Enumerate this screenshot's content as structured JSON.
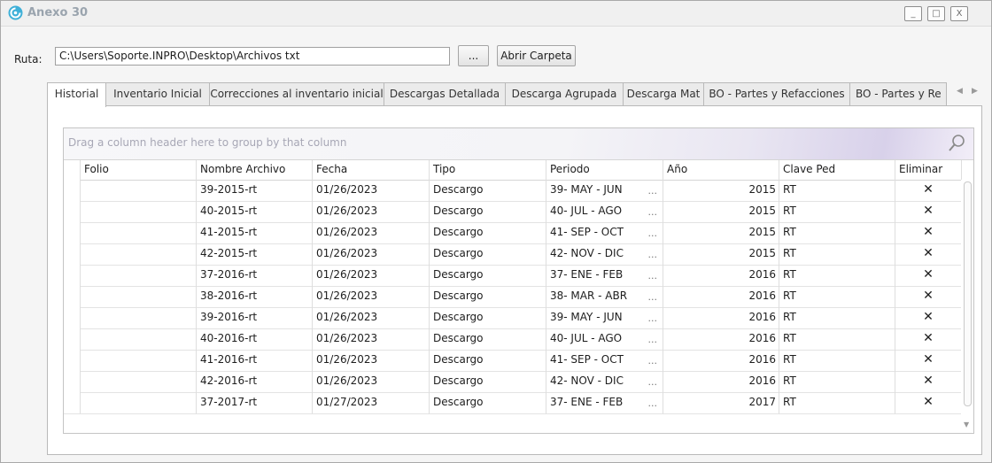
{
  "window": {
    "title": "Anexo 30",
    "minimize_label": "_",
    "maximize_label": "□",
    "close_label": "X"
  },
  "ruta": {
    "label": "Ruta:",
    "value": "C:\\Users\\Soporte.INPRO\\Desktop\\Archivos txt",
    "browse_label": "...",
    "open_folder_label": "Abrir Carpeta"
  },
  "tabs": [
    {
      "label": "Historial"
    },
    {
      "label": "Inventario Inicial"
    },
    {
      "label": "Correcciones al inventario inicial"
    },
    {
      "label": "Descargas Detallada"
    },
    {
      "label": "Descarga Agrupada"
    },
    {
      "label": "Descarga Mat"
    },
    {
      "label": "BO - Partes y Refacciones"
    },
    {
      "label": "BO - Partes y Re"
    }
  ],
  "tab_scroll": {
    "left": "◀",
    "right": "▶"
  },
  "grid": {
    "group_hint": "Drag a column header here to group by that column",
    "columns": [
      "Folio",
      "Nombre Archivo",
      "Fecha",
      "Tipo",
      "Periodo",
      "Año",
      "Clave Ped",
      "Eliminar"
    ],
    "ellipsis": "...",
    "delete_glyph": "✕",
    "rows": [
      {
        "folio": "",
        "nombre": "39-2015-rt",
        "fecha": "01/26/2023",
        "tipo": "Descargo",
        "periodo": "39- MAY - JUN",
        "anio": "2015",
        "clave": "RT"
      },
      {
        "folio": "",
        "nombre": "40-2015-rt",
        "fecha": "01/26/2023",
        "tipo": "Descargo",
        "periodo": "40- JUL - AGO",
        "anio": "2015",
        "clave": "RT"
      },
      {
        "folio": "",
        "nombre": "41-2015-rt",
        "fecha": "01/26/2023",
        "tipo": "Descargo",
        "periodo": "41- SEP - OCT",
        "anio": "2015",
        "clave": "RT"
      },
      {
        "folio": "",
        "nombre": "42-2015-rt",
        "fecha": "01/26/2023",
        "tipo": "Descargo",
        "periodo": "42- NOV - DIC",
        "anio": "2015",
        "clave": "RT"
      },
      {
        "folio": "",
        "nombre": "37-2016-rt",
        "fecha": "01/26/2023",
        "tipo": "Descargo",
        "periodo": "37- ENE - FEB",
        "anio": "2016",
        "clave": "RT"
      },
      {
        "folio": "",
        "nombre": "38-2016-rt",
        "fecha": "01/26/2023",
        "tipo": "Descargo",
        "periodo": "38- MAR - ABR",
        "anio": "2016",
        "clave": "RT"
      },
      {
        "folio": "",
        "nombre": "39-2016-rt",
        "fecha": "01/26/2023",
        "tipo": "Descargo",
        "periodo": "39- MAY - JUN",
        "anio": "2016",
        "clave": "RT"
      },
      {
        "folio": "",
        "nombre": "40-2016-rt",
        "fecha": "01/26/2023",
        "tipo": "Descargo",
        "periodo": "40- JUL - AGO",
        "anio": "2016",
        "clave": "RT"
      },
      {
        "folio": "",
        "nombre": "41-2016-rt",
        "fecha": "01/26/2023",
        "tipo": "Descargo",
        "periodo": "41- SEP - OCT",
        "anio": "2016",
        "clave": "RT"
      },
      {
        "folio": "",
        "nombre": "42-2016-rt",
        "fecha": "01/26/2023",
        "tipo": "Descargo",
        "periodo": "42- NOV - DIC",
        "anio": "2016",
        "clave": "RT"
      },
      {
        "folio": "",
        "nombre": "37-2017-rt",
        "fecha": "01/27/2023",
        "tipo": "Descargo",
        "periodo": "37- ENE - FEB",
        "anio": "2017",
        "clave": "RT"
      }
    ]
  }
}
